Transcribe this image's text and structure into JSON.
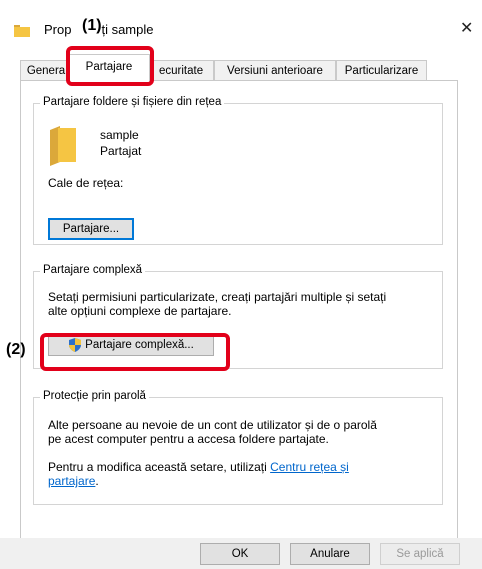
{
  "window": {
    "title_prefix": "Prop",
    "title_suffix": "ți sample",
    "close_glyph": "✕"
  },
  "callouts": {
    "one": "(1)",
    "two": "(2)"
  },
  "tabs": [
    {
      "label": "Genera",
      "active": false
    },
    {
      "label": "Partajare",
      "active": true
    },
    {
      "label": "ecuritate",
      "active": false
    },
    {
      "label": "Versiuni anterioare",
      "active": false
    },
    {
      "label": "Particularizare",
      "active": false
    }
  ],
  "network_sharing": {
    "group_title": "Partajare foldere și fișiere din rețea",
    "folder_name": "sample",
    "folder_status": "Partajat",
    "path_label": "Cale de rețea:",
    "share_button": "Partajare..."
  },
  "advanced_sharing": {
    "group_title": "Partajare complexă",
    "description_line1": "Setați permisiuni particularizate, creați partajări multiple și setați",
    "description_line2": "alte opțiuni complexe de partajare.",
    "button": "Partajare complexă..."
  },
  "password": {
    "group_title": "Protecție prin parolă",
    "line1": "Alte persoane au nevoie de un cont de utilizator și de o parolă",
    "line2": "pe acest computer pentru a accesa foldere partajate.",
    "line3_prefix": "Pentru a modifica această setare, utilizați ",
    "link_part1": "Centru rețea și",
    "link_part2": "partajare",
    "line4_suffix": "."
  },
  "footer": {
    "ok": "OK",
    "cancel": "Anulare",
    "apply": "Se aplică"
  },
  "colors": {
    "highlight": "#e2001a",
    "link": "#0066cc",
    "folder": "#f5c543"
  }
}
